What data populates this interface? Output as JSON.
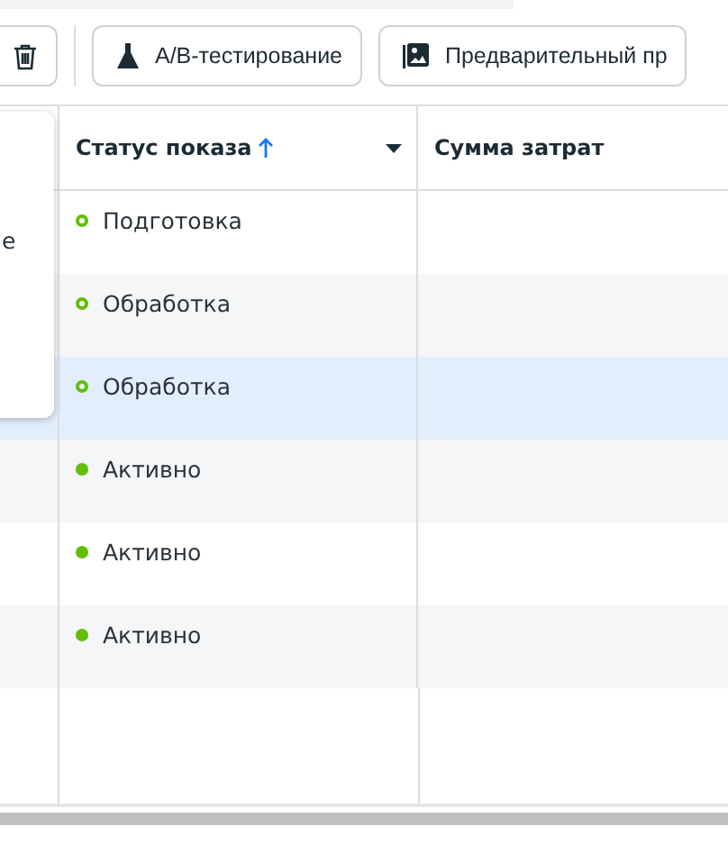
{
  "toolbar": {
    "buttons": [
      {
        "kind": "trash"
      },
      {
        "kind": "flask",
        "label": "A/B-тестирование"
      },
      {
        "kind": "image",
        "label": "Предварительный пр"
      }
    ]
  },
  "popup": {
    "text": "е"
  },
  "table": {
    "columns": [
      {
        "label": "Статус показа",
        "sort_arrow": true,
        "menu": true
      },
      {
        "label": "Сумма затрат",
        "sort_arrow": false,
        "menu": false
      }
    ],
    "rows": [
      {
        "status": "Подготовка",
        "kind": "hollow",
        "highlighted": false
      },
      {
        "status": "Обработка",
        "kind": "hollow",
        "highlighted": false
      },
      {
        "status": "Обработка",
        "kind": "hollow",
        "highlighted": true
      },
      {
        "status": "Активно",
        "kind": "filled",
        "highlighted": false
      },
      {
        "status": "Активно",
        "kind": "filled",
        "highlighted": false
      },
      {
        "status": "Активно",
        "kind": "filled",
        "highlighted": false
      }
    ]
  }
}
